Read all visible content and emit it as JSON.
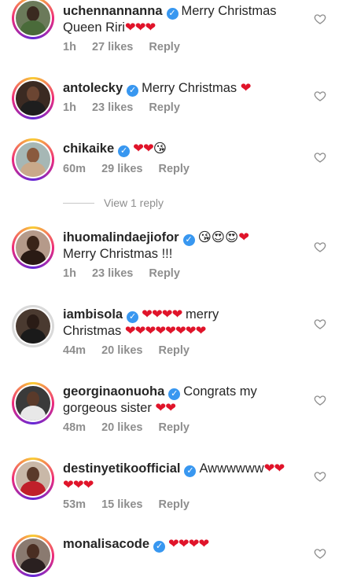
{
  "comments": [
    {
      "username": "uchennannanna",
      "text_a": "Merry Christmas",
      "text_b": "Queen Riri",
      "hearts": "❤❤❤",
      "time": "1h",
      "likes": "27 likes",
      "reply": "Reply"
    },
    {
      "username": "antolecky",
      "text_a": "Merry Christmas",
      "hearts": "❤",
      "time": "1h",
      "likes": "23 likes",
      "reply": "Reply"
    },
    {
      "username": "chikaike",
      "hearts": "❤❤",
      "emoji": "😘",
      "time": "60m",
      "likes": "29 likes",
      "reply": "Reply"
    },
    {
      "username": "ihuomalindaejiofor",
      "emoji": "😘😍😍",
      "hearts": "❤",
      "text_b": "Merry Christmas !!!",
      "time": "1h",
      "likes": "23 likes",
      "reply": "Reply"
    },
    {
      "username": "iambisola",
      "hearts": "❤❤❤❤",
      "text_a": "merry",
      "text_b": "Christmas",
      "hearts_b": "❤❤❤❤❤❤❤❤",
      "time": "44m",
      "likes": "20 likes",
      "reply": "Reply"
    },
    {
      "username": "georginaonuoha",
      "text_a": "Congrats my",
      "text_b": "gorgeous sister",
      "hearts": "❤❤",
      "time": "48m",
      "likes": "20 likes",
      "reply": "Reply"
    },
    {
      "username": "destinyetikoofficial",
      "text_a": "Awwwwww",
      "hearts": "❤❤",
      "hearts_b": "❤❤❤",
      "time": "53m",
      "likes": "15 likes",
      "reply": "Reply"
    },
    {
      "username": "monalisacode",
      "hearts": "❤❤❤❤"
    }
  ],
  "view_reply": "View 1 reply",
  "icons": {
    "verified": "verified-badge-icon",
    "like": "heart-outline-icon"
  },
  "colors": {
    "verified": "#3897f0",
    "heart": "#e0142a",
    "meta": "#8e8e8e"
  }
}
